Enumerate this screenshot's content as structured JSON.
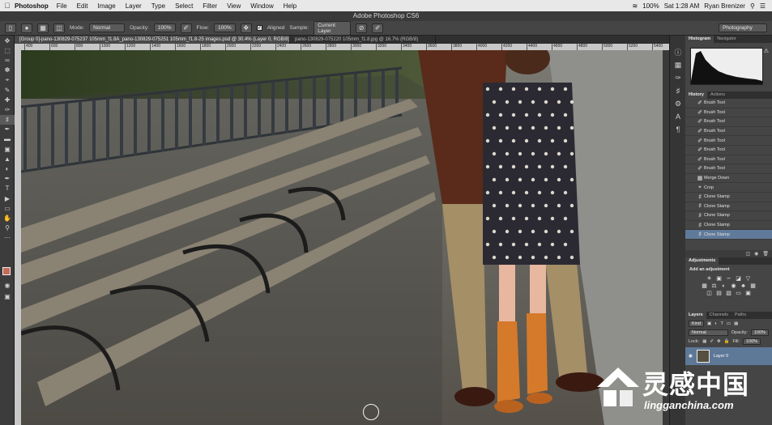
{
  "menubar": {
    "app": "Photoshop",
    "items": [
      "File",
      "Edit",
      "Image",
      "Layer",
      "Type",
      "Select",
      "Filter",
      "View",
      "Window",
      "Help"
    ],
    "clock": "Sat 1:28 AM",
    "user": "Ryan Brenizer",
    "battery": "100%"
  },
  "window_title": "Adobe Photoshop CS6",
  "options": {
    "mode_label": "Mode:",
    "mode_value": "Normal",
    "opacity_label": "Opacity:",
    "opacity_value": "100%",
    "flow_label": "Flow:",
    "flow_value": "100%",
    "aligned_label": "Aligned",
    "sample_label": "Sample:",
    "sample_value": "Current Layer",
    "workspace": "Photography"
  },
  "tabs": [
    "[Group 0]-pano-130829-075237 105mm_f1.8A_pano-130829-075251 105mm_f1.8-25 images.psd @ 30.4% (Layer 0, RGB/8)",
    "pano-130829-075220 105mm_f1.8.jpg @ 16.7% (RGB/8)"
  ],
  "ruler": [
    "400",
    "600",
    "800",
    "1000",
    "1200",
    "1400",
    "1600",
    "1800",
    "2000",
    "2200",
    "2400",
    "2600",
    "2800",
    "3000",
    "3200",
    "3400",
    "3600",
    "3800",
    "4000",
    "4200",
    "4400",
    "4600",
    "4800",
    "5000",
    "5200",
    "5400"
  ],
  "panels": {
    "histogram_tab": "Histogram",
    "navigator_tab": "Navigator",
    "history_tab": "History",
    "actions_tab": "Actions",
    "history_items": [
      "Brush Tool",
      "Brush Tool",
      "Brush Tool",
      "Brush Tool",
      "Brush Tool",
      "Brush Tool",
      "Brush Tool",
      "Brush Tool",
      "Merge Down",
      "Crop",
      "Clone Stamp",
      "Clone Stamp",
      "Clone Stamp",
      "Clone Stamp",
      "Clone Stamp"
    ],
    "adjustments_tab": "Adjustments",
    "adjust_hint": "Add an adjustment",
    "layers_tab": "Layers",
    "channels_tab": "Channels",
    "paths_tab": "Paths",
    "kind_label": "Kind",
    "blend_value": "Normal",
    "layer_opacity_label": "Opacity:",
    "layer_opacity_value": "100%",
    "lock_label": "Lock:",
    "fill_label": "Fill:",
    "fill_value": "100%",
    "layer_name": "Layer 0"
  },
  "watermark": {
    "cn": "灵感中国",
    "url": "lingganchina.com"
  },
  "colors": {
    "foreground": "#c86a5a",
    "background": "#ffffff",
    "selection": "#607a9a",
    "boots": "#d57a2a"
  }
}
